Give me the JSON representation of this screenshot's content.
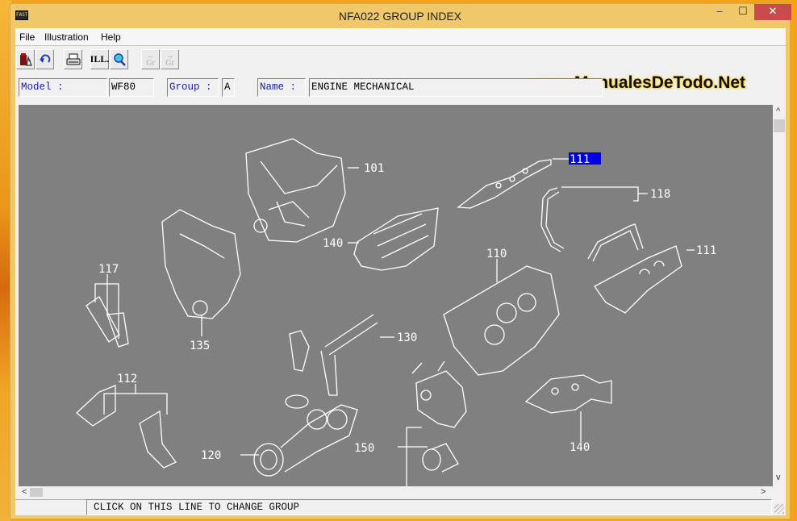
{
  "window": {
    "title": "NFA022 GROUP INDEX",
    "app_icon_text": "FAST",
    "controls": {
      "minimize": "–",
      "maximize": "☐",
      "close": "✕"
    }
  },
  "menu": {
    "items": [
      "File",
      "Illustration",
      "Help"
    ]
  },
  "toolbar": {
    "buttons": [
      {
        "name": "parts-book",
        "icon": "book-icon",
        "enabled": true
      },
      {
        "name": "back",
        "icon": "undo-arrow-icon",
        "enabled": true
      },
      {
        "name": "print",
        "icon": "printer-icon",
        "enabled": true
      },
      {
        "name": "illustration",
        "label": "ILL.",
        "enabled": true
      },
      {
        "name": "search",
        "icon": "magnifier-icon",
        "enabled": true
      },
      {
        "name": "previous-group",
        "label": "Gr",
        "enabled": false
      },
      {
        "name": "next-group",
        "label": "Gr",
        "enabled": false
      }
    ],
    "ill_label": "ILL.",
    "gr_label": "Gr",
    "arrow_left": "←",
    "arrow_right": "→"
  },
  "watermark": "www.ManualesDeTodo.Net",
  "info": {
    "model_label": "Model  :",
    "model_value": "WF80",
    "group_label": "Group :",
    "group_value": "A",
    "name_label": "Name  :",
    "name_value": "ENGINE MECHANICAL"
  },
  "illustration": {
    "callouts": [
      {
        "id": "101",
        "label": "101"
      },
      {
        "id": "111-top",
        "label": "111",
        "selected": true
      },
      {
        "id": "118",
        "label": "118"
      },
      {
        "id": "140-top",
        "label": "140"
      },
      {
        "id": "111-right",
        "label": "111"
      },
      {
        "id": "110",
        "label": "110"
      },
      {
        "id": "117",
        "label": "117"
      },
      {
        "id": "135",
        "label": "135"
      },
      {
        "id": "130",
        "label": "130"
      },
      {
        "id": "112",
        "label": "112"
      },
      {
        "id": "120",
        "label": "120"
      },
      {
        "id": "150",
        "label": "150"
      },
      {
        "id": "140-bottom",
        "label": "140"
      }
    ],
    "selection_color": "#0000e6",
    "background_color": "#808080"
  },
  "scroll": {
    "up": "^",
    "down": "v",
    "left": "<",
    "right": ">"
  },
  "status": {
    "text": "CLICK ON THIS LINE TO CHANGE GROUP"
  }
}
